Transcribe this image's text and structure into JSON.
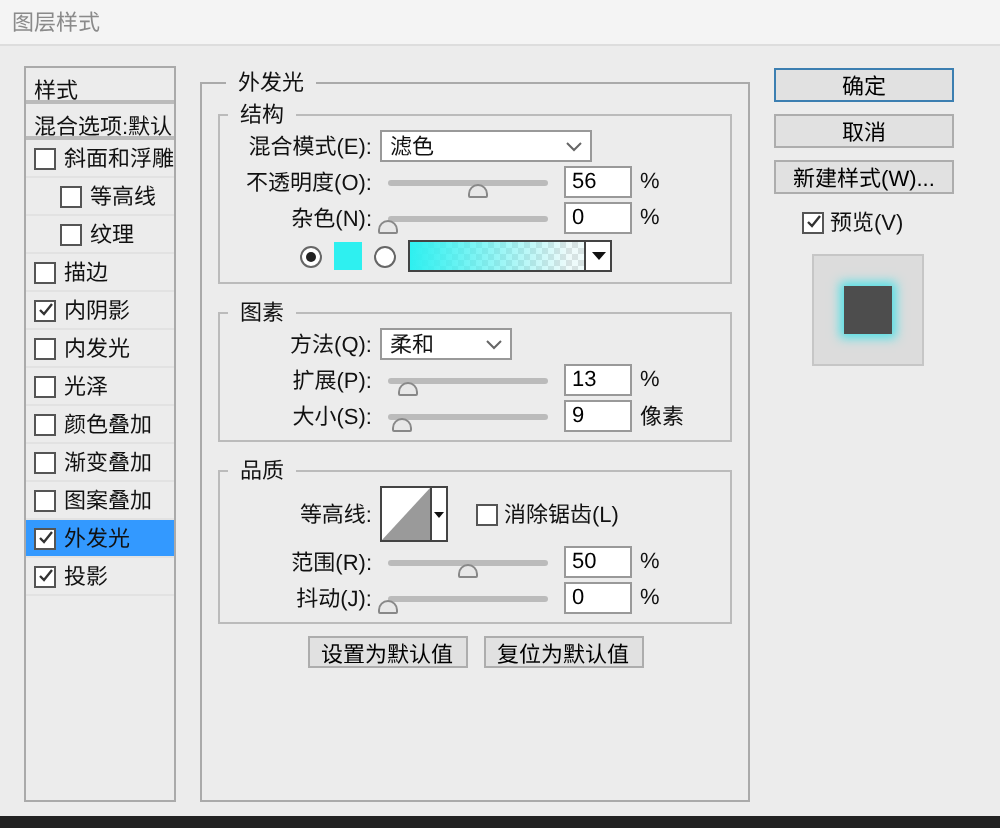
{
  "window": {
    "title": "图层样式"
  },
  "sidebar": {
    "header": "样式",
    "blend_options": "混合选项:默认",
    "items": [
      {
        "label": "斜面和浮雕",
        "checked": false,
        "selected": false,
        "children": [
          {
            "label": "等高线",
            "checked": false,
            "selected": false
          },
          {
            "label": "纹理",
            "checked": false,
            "selected": false
          }
        ]
      },
      {
        "label": "描边",
        "checked": false,
        "selected": false
      },
      {
        "label": "内阴影",
        "checked": true,
        "selected": false
      },
      {
        "label": "内发光",
        "checked": false,
        "selected": false
      },
      {
        "label": "光泽",
        "checked": false,
        "selected": false
      },
      {
        "label": "颜色叠加",
        "checked": false,
        "selected": false
      },
      {
        "label": "渐变叠加",
        "checked": false,
        "selected": false
      },
      {
        "label": "图案叠加",
        "checked": false,
        "selected": false
      },
      {
        "label": "外发光",
        "checked": true,
        "selected": true
      },
      {
        "label": "投影",
        "checked": true,
        "selected": false
      }
    ]
  },
  "panel": {
    "title": "外发光",
    "sections": [
      {
        "title": "结构",
        "rows": [
          {
            "kind": "select",
            "label": "混合模式(E):",
            "value": "滤色",
            "wide": true
          },
          {
            "kind": "slider",
            "label": "不透明度(O):",
            "level": 0.56,
            "value": "56",
            "unit": "%"
          },
          {
            "kind": "slider",
            "label": "杂色(N):",
            "level": 0,
            "value": "0",
            "unit": "%"
          },
          {
            "kind": "colors",
            "options": [
              {
                "kind": "solid",
                "selected": true,
                "color": "#2ef0f0"
              },
              {
                "kind": "gradient",
                "selected": false
              }
            ]
          }
        ]
      },
      {
        "title": "图素",
        "rows": [
          {
            "kind": "select",
            "label": "方法(Q):",
            "value": "柔和",
            "wide": false
          },
          {
            "kind": "slider",
            "label": "扩展(P):",
            "level": 0.13,
            "value": "13",
            "unit": "%"
          },
          {
            "kind": "slider",
            "label": "大小(S):",
            "level": 0.09,
            "value": "9",
            "unit": "像素"
          }
        ]
      },
      {
        "title": "品质",
        "rows": [
          {
            "kind": "contour",
            "label": "等高线:",
            "antialias": {
              "label": "消除锯齿(L)",
              "checked": false
            }
          },
          {
            "kind": "slider",
            "label": "范围(R):",
            "level": 0.5,
            "value": "50",
            "unit": "%"
          },
          {
            "kind": "slider",
            "label": "抖动(J):",
            "level": 0,
            "value": "0",
            "unit": "%"
          }
        ]
      }
    ],
    "buttons": [
      "设置为默认值",
      "复位为默认值"
    ]
  },
  "actions": [
    {
      "label": "确定",
      "primary": true
    },
    {
      "label": "取消",
      "primary": false
    },
    {
      "label": "新建样式(W)...",
      "primary": false
    }
  ],
  "preview": {
    "label": "预览(V)",
    "checked": true
  }
}
